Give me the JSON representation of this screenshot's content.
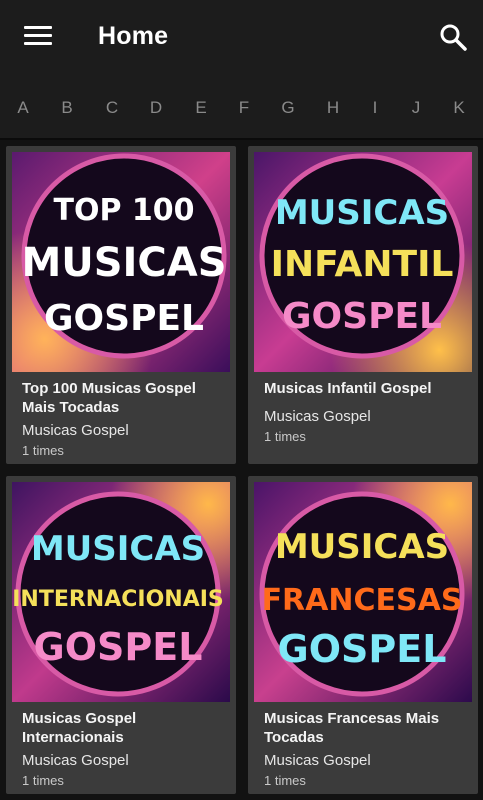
{
  "header": {
    "title": "Home",
    "menu_icon": "menu-icon",
    "search_icon": "search-icon"
  },
  "alphabet": [
    "A",
    "B",
    "C",
    "D",
    "E",
    "F",
    "G",
    "H",
    "I",
    "J",
    "K"
  ],
  "cards": [
    {
      "title": "Top 100 Musicas Gospel Mais Tocadas",
      "subtitle": "Musicas Gospel",
      "count": "1 times",
      "cover_lines": [
        "TOP 100",
        "MUSICAS",
        "GOSPEL"
      ],
      "cover_colors": [
        "#ffffff",
        "#ffffff",
        "#ffffff"
      ]
    },
    {
      "title": "Musicas Infantil Gospel",
      "subtitle": "Musicas Gospel",
      "count": "1 times",
      "cover_lines": [
        "MUSICAS",
        "INFANTIL",
        "GOSPEL"
      ],
      "cover_colors": [
        "#7fe7f7",
        "#f5e05a",
        "#f58ac8"
      ]
    },
    {
      "title": "Musicas Gospel Internacionais",
      "subtitle": "Musicas Gospel",
      "count": "1 times",
      "cover_lines": [
        "MUSICAS",
        "INTERNACIONAIS",
        "GOSPEL"
      ],
      "cover_colors": [
        "#7fe7f7",
        "#f5e05a",
        "#f58ac8"
      ]
    },
    {
      "title": "Musicas Francesas Mais Tocadas",
      "subtitle": "Musicas Gospel",
      "count": "1 times",
      "cover_lines": [
        "MUSICAS",
        "FRANCESAS",
        "GOSPEL"
      ],
      "cover_colors": [
        "#f5e05a",
        "#ff6a1a",
        "#7fe7f7"
      ]
    }
  ]
}
